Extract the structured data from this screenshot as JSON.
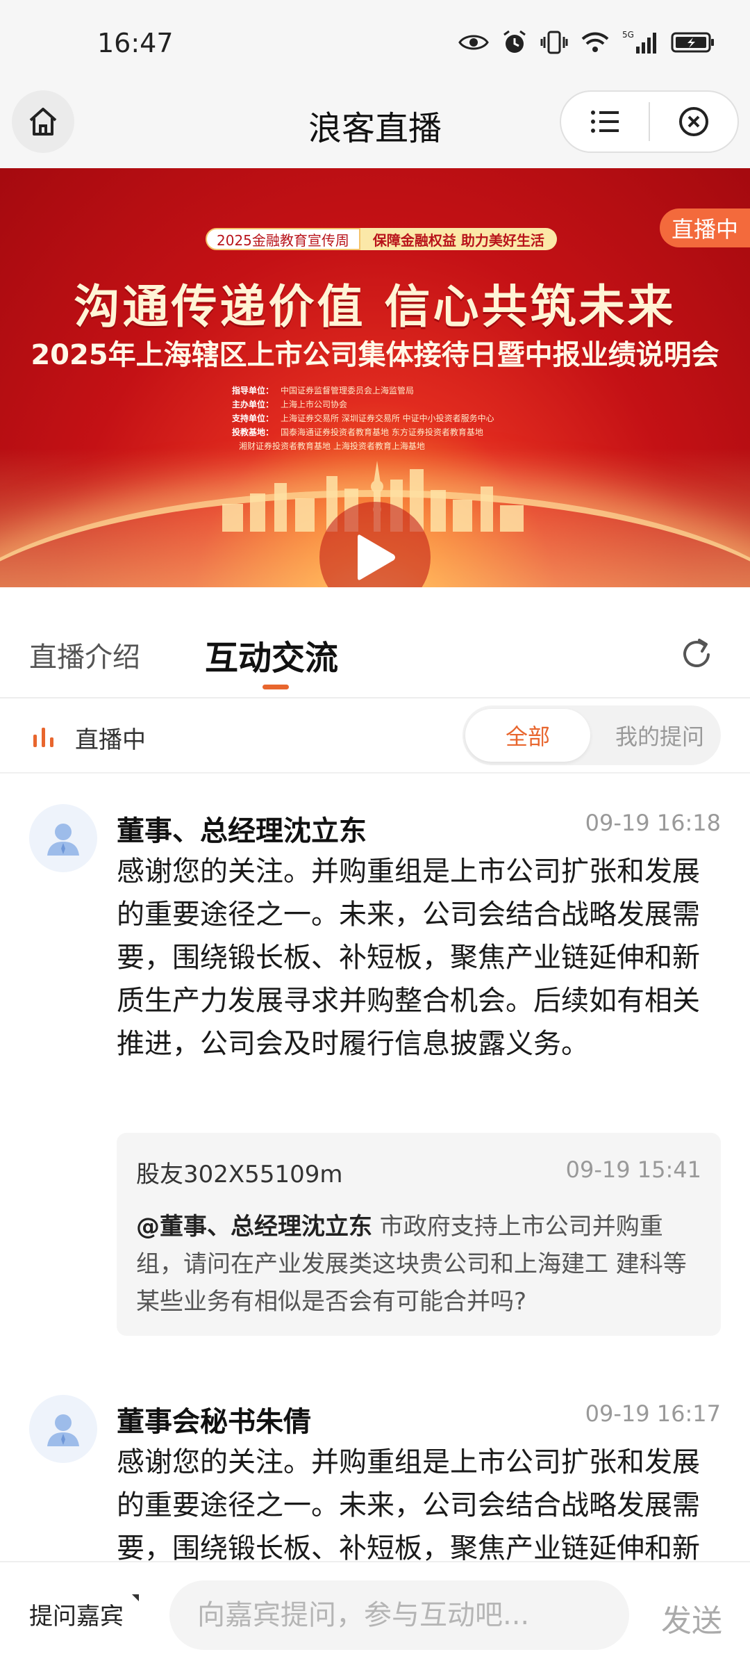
{
  "status_bar": {
    "time": "16:47",
    "network": "5G"
  },
  "header": {
    "title": "浪客直播"
  },
  "video": {
    "live_badge": "直播中",
    "tag_left": "2025金融教育宣传周",
    "tag_right": "保障金融权益 助力美好生活",
    "slogan": "沟通传递价值 信心共筑未来",
    "main_title": "2025年上海辖区上市公司集体接待日暨中报业绩说明会",
    "sponsors": [
      {
        "role": "指导单位：",
        "names": "中国证券监督管理委员会上海监管局"
      },
      {
        "role": "主办单位：",
        "names": "上海上市公司协会"
      },
      {
        "role": "支持单位：",
        "names": "上海证券交易所 深圳证券交易所 中证中小投资者服务中心"
      },
      {
        "role": "投教基地：",
        "names": "国泰海通证券投资者教育基地 东方证券投资者教育基地"
      },
      {
        "role": "",
        "names": "湘财证券投资者教育基地 上海投资者教育上海基地"
      }
    ]
  },
  "tabs": {
    "intro": "直播介绍",
    "interaction": "互动交流"
  },
  "live_row": {
    "label": "直播中",
    "filter_all": "全部",
    "filter_mine": "我的提问"
  },
  "posts": [
    {
      "author": "董事、总经理沈立东",
      "time": "09-19 16:18",
      "answer": "感谢您的关注。并购重组是上市公司扩张和发展的重要途径之一。未来，公司会结合战略发展需要，围绕锻长板、补短板，聚焦产业链延伸和新质生产力发展寻求并购整合机会。后续如有相关推进，公司会及时履行信息披露义务。",
      "question": {
        "user": "股友302X55109m",
        "time": "09-19 15:41",
        "mention": "@董事、总经理沈立东",
        "text": " 市政府支持上市公司并购重组，请问在产业发展类这块贵公司和上海建工 建科等某些业务有相似是否会有可能合并吗?"
      }
    },
    {
      "author": "董事会秘书朱倩",
      "time": "09-19 16:17",
      "answer": "感谢您的关注。并购重组是上市公司扩张和发展的重要途径之一。未来，公司会结合战略发展需要，围绕锻长板、补短板，聚焦产业链延伸和新质生产力发展寻求并购整合机会。"
    }
  ],
  "bottom_bar": {
    "ask_guest": "提问嘉宾",
    "input_placeholder": "向嘉宾提问，参与互动吧...",
    "send": "发送"
  },
  "colors": {
    "accent": "#e8662e",
    "live_badge": "#f36a3c",
    "banner_red": "#c41115"
  }
}
